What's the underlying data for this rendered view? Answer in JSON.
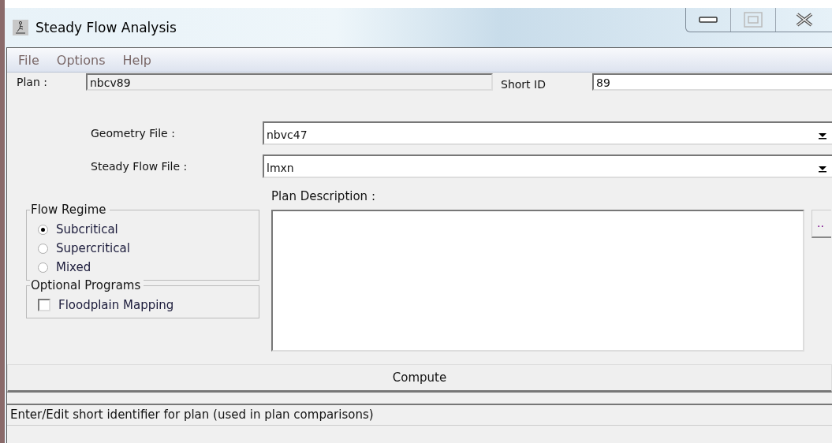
{
  "window": {
    "title": "Steady Flow Analysis"
  },
  "menu": [
    "File",
    "Options",
    "Help"
  ],
  "plan": {
    "label": "Plan :",
    "value": "nbcv89"
  },
  "short_id": {
    "label": "Short ID",
    "value": "89"
  },
  "geometry_file": {
    "label": "Geometry File :",
    "value": "nbvc47"
  },
  "steady_flow_file": {
    "label": "Steady Flow File :",
    "value": "lmxn"
  },
  "plan_description": {
    "label": "Plan Description :",
    "button": ".."
  },
  "flow_regime": {
    "title": "Flow Regime",
    "options": [
      {
        "label": "Subcritical",
        "selected": true
      },
      {
        "label": "Supercritical",
        "selected": false
      },
      {
        "label": "Mixed",
        "selected": false
      }
    ]
  },
  "optional_programs": {
    "title": "Optional Programs",
    "items": [
      {
        "label": "Floodplain Mapping",
        "checked": false
      }
    ]
  },
  "compute_button": "Compute",
  "status_bar": "Enter/Edit short identifier for plan (used in plan comparisons)"
}
